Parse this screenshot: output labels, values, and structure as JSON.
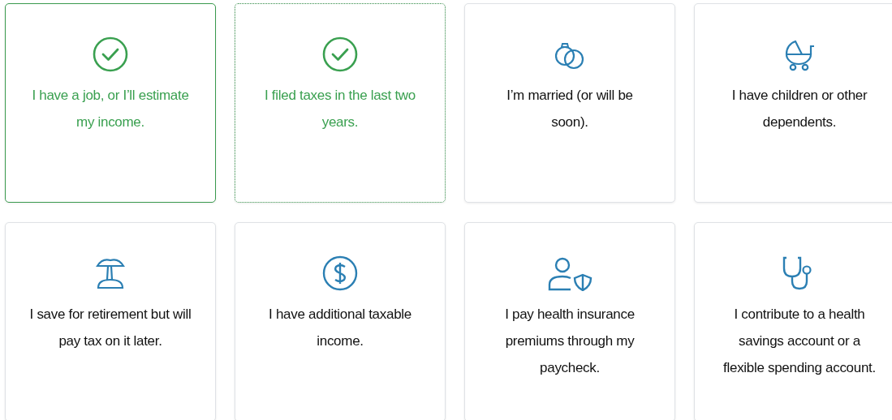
{
  "options": [
    {
      "label": "I have a job, or I’ll estimate my income.",
      "selected": true,
      "focused": false
    },
    {
      "label": "I filed taxes in the last two years.",
      "selected": true,
      "focused": true
    },
    {
      "label": "I’m married (or will be soon).",
      "selected": false,
      "focused": false
    },
    {
      "label": "I have children or other dependents.",
      "selected": false,
      "focused": false
    },
    {
      "label": "I save for retirement but will pay tax on it later.",
      "selected": false,
      "focused": false
    },
    {
      "label": "I have additional taxable income.",
      "selected": false,
      "focused": false
    },
    {
      "label": "I pay health insurance premiums through my paycheck.",
      "selected": false,
      "focused": false
    },
    {
      "label": "I contribute to a health savings account or a flexible spending account.",
      "selected": false,
      "focused": false
    }
  ]
}
